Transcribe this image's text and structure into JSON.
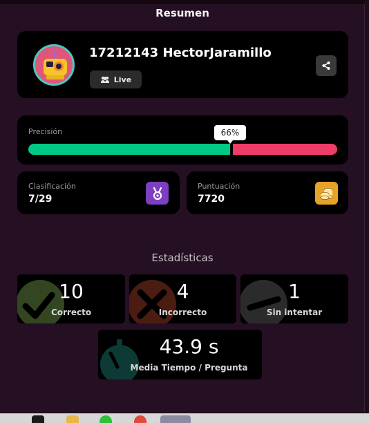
{
  "header": {
    "title": "Resumen"
  },
  "profile": {
    "name": "17212143 HectorJaramillo",
    "mode_label": "Live",
    "avatar_icon": "avatar-robot",
    "share_icon": "share-icon"
  },
  "accuracy": {
    "label": "Precisión",
    "percent_label": "66%",
    "percent": 66,
    "correct_color": "#00c985",
    "incorrect_color": "#ef3c69"
  },
  "ranking": {
    "label": "Clasificación",
    "value": "7/29",
    "icon": "medal-icon",
    "icon_color": "#7b3fbf"
  },
  "score": {
    "label": "Puntuación",
    "value": "7720",
    "icon": "coins-icon",
    "icon_color": "#e7a22a"
  },
  "stats": {
    "title": "Estadísticas",
    "correct": {
      "value": "10",
      "label": "Correcto"
    },
    "incorrect": {
      "value": "4",
      "label": "Incorrecto"
    },
    "unattempted": {
      "value": "1",
      "label": "Sin intentar"
    },
    "avg_time": {
      "value": "43.9 s",
      "label": "Media Tiempo / Pregunta"
    }
  }
}
